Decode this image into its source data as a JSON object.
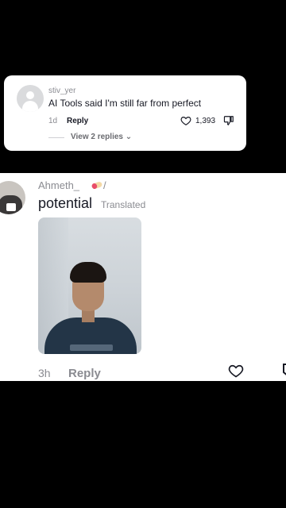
{
  "top_comment": {
    "username": "stiv_yer",
    "text": "AI Tools said I'm still far from perfect",
    "age": "1d",
    "reply_label": "Reply",
    "likes": "1,393",
    "view_replies": "View 2 replies ⌄"
  },
  "main_comment": {
    "username": "Ahmeth_",
    "username_suffix": "/",
    "text": "potential",
    "translated_label": "Translated",
    "age": "3h",
    "reply_label": "Reply"
  },
  "colors": {
    "background": "#000000",
    "card": "#ffffff",
    "muted_text": "#8a8b91",
    "primary_text": "#161823"
  },
  "icons": [
    "avatar-default-icon",
    "heart-outline-icon",
    "thumbs-down-outline-icon",
    "pill-emoji-icon"
  ]
}
